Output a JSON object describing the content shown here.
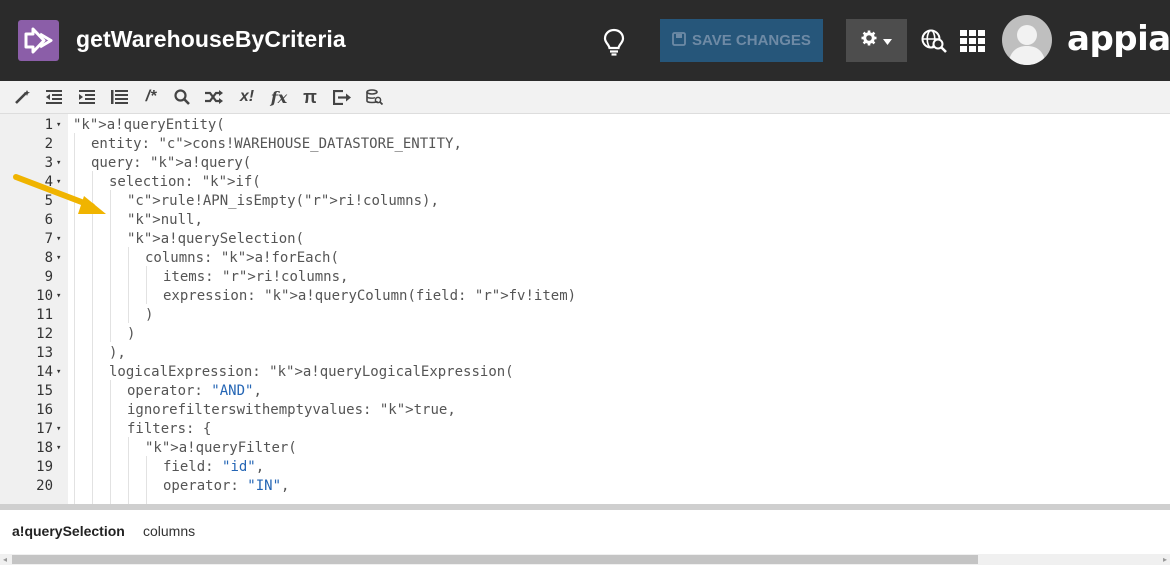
{
  "header": {
    "title": "getWarehouseByCriteria",
    "save_label": "SAVE CHANGES",
    "brand": "appian"
  },
  "toolbar": {
    "tools": [
      "magic-wand",
      "outdent",
      "indent",
      "format",
      "/*",
      "search",
      "shuffle",
      "x!",
      "f(x)",
      "π",
      "export",
      "database"
    ],
    "comment_label": "/*",
    "x_label": "x!",
    "fx_label": "fx",
    "pi_label": "π"
  },
  "editor": {
    "lines": [
      {
        "n": "1",
        "fold": true,
        "text": "a!queryEntity("
      },
      {
        "n": "2",
        "fold": false,
        "text": "entity: cons!WAREHOUSE_DATASTORE_ENTITY,"
      },
      {
        "n": "3",
        "fold": true,
        "text": "query: a!query("
      },
      {
        "n": "4",
        "fold": true,
        "text": "selection: if("
      },
      {
        "n": "5",
        "fold": false,
        "text": "rule!APN_isEmpty(ri!columns),"
      },
      {
        "n": "6",
        "fold": false,
        "text": "null,"
      },
      {
        "n": "7",
        "fold": true,
        "text": "a!querySelection("
      },
      {
        "n": "8",
        "fold": true,
        "text": "columns: a!forEach("
      },
      {
        "n": "9",
        "fold": false,
        "text": "items: ri!columns,"
      },
      {
        "n": "10",
        "fold": true,
        "text": "expression: a!queryColumn(field: fv!item)"
      },
      {
        "n": "11",
        "fold": false,
        "text": ")"
      },
      {
        "n": "12",
        "fold": false,
        "text": ")"
      },
      {
        "n": "13",
        "fold": false,
        "text": "),"
      },
      {
        "n": "14",
        "fold": true,
        "text": "logicalExpression: a!queryLogicalExpression("
      },
      {
        "n": "15",
        "fold": false,
        "text": "operator: \"AND\","
      },
      {
        "n": "16",
        "fold": false,
        "text": "ignorefilterswithemptyvalues: true,"
      },
      {
        "n": "17",
        "fold": true,
        "text": "filters: {"
      },
      {
        "n": "18",
        "fold": true,
        "text": "a!queryFilter("
      },
      {
        "n": "19",
        "fold": false,
        "text": "field: \"id\","
      },
      {
        "n": "20",
        "fold": false,
        "text": "operator: \"IN\","
      }
    ]
  },
  "hint": {
    "function": "a!querySelection",
    "argument": "columns"
  },
  "colors": {
    "topbar": "#2b2b2b",
    "app_icon": "#8b5ea8",
    "save_button": "#26567a",
    "keyword": "#1d5fa8",
    "constant": "#e8792a",
    "rule_input": "#3399cc",
    "annotation_arrow": "#f0b400"
  }
}
